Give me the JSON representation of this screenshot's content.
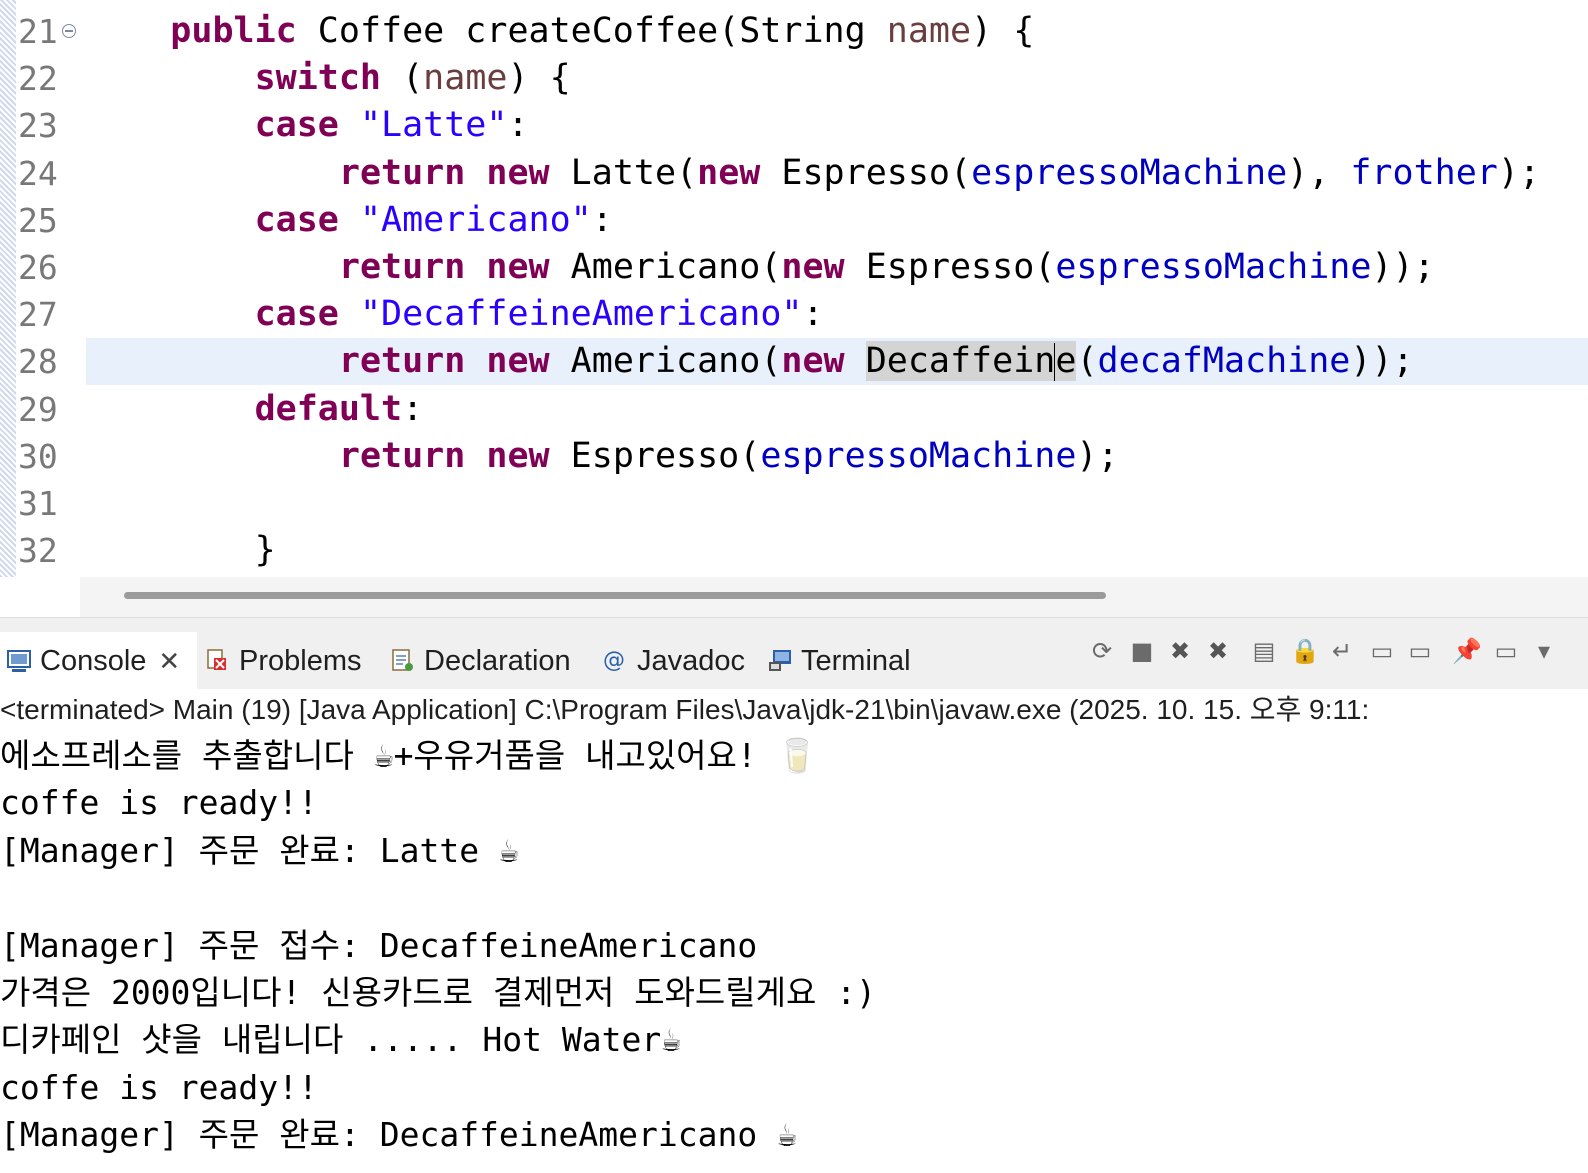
{
  "editor": {
    "lines": [
      {
        "num": "21",
        "fold": true,
        "tokens": [
          {
            "t": "    "
          },
          {
            "t": "public",
            "c": "kw"
          },
          {
            "t": " Coffee createCoffee(String "
          },
          {
            "t": "name",
            "c": "par"
          },
          {
            "t": ") {"
          }
        ]
      },
      {
        "num": "22",
        "tokens": [
          {
            "t": "        "
          },
          {
            "t": "switch",
            "c": "kw"
          },
          {
            "t": " ("
          },
          {
            "t": "name",
            "c": "par"
          },
          {
            "t": ") {"
          }
        ]
      },
      {
        "num": "23",
        "tokens": [
          {
            "t": "        "
          },
          {
            "t": "case",
            "c": "kw"
          },
          {
            "t": " "
          },
          {
            "t": "\"Latte\"",
            "c": "str"
          },
          {
            "t": ":"
          }
        ]
      },
      {
        "num": "24",
        "tokens": [
          {
            "t": "            "
          },
          {
            "t": "return",
            "c": "kw"
          },
          {
            "t": " "
          },
          {
            "t": "new",
            "c": "kw"
          },
          {
            "t": " Latte("
          },
          {
            "t": "new",
            "c": "kw"
          },
          {
            "t": " Espresso("
          },
          {
            "t": "espressoMachine",
            "c": "fld"
          },
          {
            "t": "), "
          },
          {
            "t": "frother",
            "c": "fld"
          },
          {
            "t": ");"
          }
        ]
      },
      {
        "num": "25",
        "tokens": [
          {
            "t": "        "
          },
          {
            "t": "case",
            "c": "kw"
          },
          {
            "t": " "
          },
          {
            "t": "\"Americano\"",
            "c": "str"
          },
          {
            "t": ":"
          }
        ]
      },
      {
        "num": "26",
        "tokens": [
          {
            "t": "            "
          },
          {
            "t": "return",
            "c": "kw"
          },
          {
            "t": " "
          },
          {
            "t": "new",
            "c": "kw"
          },
          {
            "t": " Americano("
          },
          {
            "t": "new",
            "c": "kw"
          },
          {
            "t": " Espresso("
          },
          {
            "t": "espressoMachine",
            "c": "fld"
          },
          {
            "t": "));"
          }
        ]
      },
      {
        "num": "27",
        "tokens": [
          {
            "t": "        "
          },
          {
            "t": "case",
            "c": "kw"
          },
          {
            "t": " "
          },
          {
            "t": "\"DecaffeineAmericano\"",
            "c": "str"
          },
          {
            "t": ":"
          }
        ]
      },
      {
        "num": "28",
        "current": true,
        "tokens": [
          {
            "t": "            "
          },
          {
            "t": "return",
            "c": "kw"
          },
          {
            "t": " "
          },
          {
            "t": "new",
            "c": "kw"
          },
          {
            "t": " Americano("
          },
          {
            "t": "new",
            "c": "kw"
          },
          {
            "t": " "
          },
          {
            "t": "Decaffein",
            "c": "mark"
          },
          {
            "caret": true
          },
          {
            "t": "e",
            "c": "mark"
          },
          {
            "t": "("
          },
          {
            "t": "decafMachine",
            "c": "fld"
          },
          {
            "t": "));"
          }
        ]
      },
      {
        "num": "29",
        "tokens": [
          {
            "t": "        "
          },
          {
            "t": "default",
            "c": "kw"
          },
          {
            "t": ":"
          }
        ]
      },
      {
        "num": "30",
        "tokens": [
          {
            "t": "            "
          },
          {
            "t": "return",
            "c": "kw"
          },
          {
            "t": " "
          },
          {
            "t": "new",
            "c": "kw"
          },
          {
            "t": " Espresso("
          },
          {
            "t": "espressoMachine",
            "c": "fld"
          },
          {
            "t": ");"
          }
        ]
      },
      {
        "num": "31",
        "tokens": []
      },
      {
        "num": "32",
        "tokens": [
          {
            "t": "        }"
          }
        ]
      }
    ]
  },
  "tabs": [
    {
      "label": "Console",
      "icon": "console-icon",
      "active": true,
      "closable": true
    },
    {
      "label": "Problems",
      "icon": "problems-icon"
    },
    {
      "label": "Declaration",
      "icon": "declaration-icon"
    },
    {
      "label": "Javadoc",
      "icon": "javadoc-icon"
    },
    {
      "label": "Terminal",
      "icon": "terminal-icon"
    }
  ],
  "toolbar": [
    {
      "name": "pin-console-icon",
      "glyph": "⟳"
    },
    {
      "name": "terminate-icon",
      "glyph": "■"
    },
    {
      "name": "remove-launch-icon",
      "glyph": "✖"
    },
    {
      "name": "remove-all-terminated-icon",
      "glyph": "✖"
    },
    {
      "name": "clear-console-icon",
      "glyph": "▤"
    },
    {
      "name": "scroll-lock-icon",
      "glyph": "🔒"
    },
    {
      "name": "word-wrap-icon",
      "glyph": "↵"
    },
    {
      "name": "show-on-stdout-icon",
      "glyph": "▭"
    },
    {
      "name": "show-on-stderr-icon",
      "glyph": "▭"
    },
    {
      "name": "pin-icon",
      "glyph": "📌"
    },
    {
      "name": "display-console-icon",
      "glyph": "▭"
    },
    {
      "name": "view-menu-icon",
      "glyph": "▾"
    }
  ],
  "console": {
    "status": "<terminated> Main (19) [Java Application] C:\\Program Files\\Java\\jdk-21\\bin\\javaw.exe  (2025. 10. 15. 오후 9:11:",
    "lines": [
      "에소프레소를 추출합니다 ☕+우유거품을 내고있어요! 🥛",
      "coffe is ready!!",
      "[Manager] 주문 완료: Latte ☕",
      "",
      "[Manager] 주문 접수: DecaffeineAmericano",
      "가격은 2000입니다! 신용카드로 결제먼저 도와드릴게요 :)",
      "디카페인 샷을 내립니다 ..... Hot Water☕",
      "coffe is ready!!",
      "[Manager] 주문 완료: DecaffeineAmericano ☕"
    ]
  },
  "colors": {
    "keyword": "#7f0055",
    "string": "#2a00ff",
    "field": "#0000c0",
    "current_line": "#e8f0fb"
  }
}
